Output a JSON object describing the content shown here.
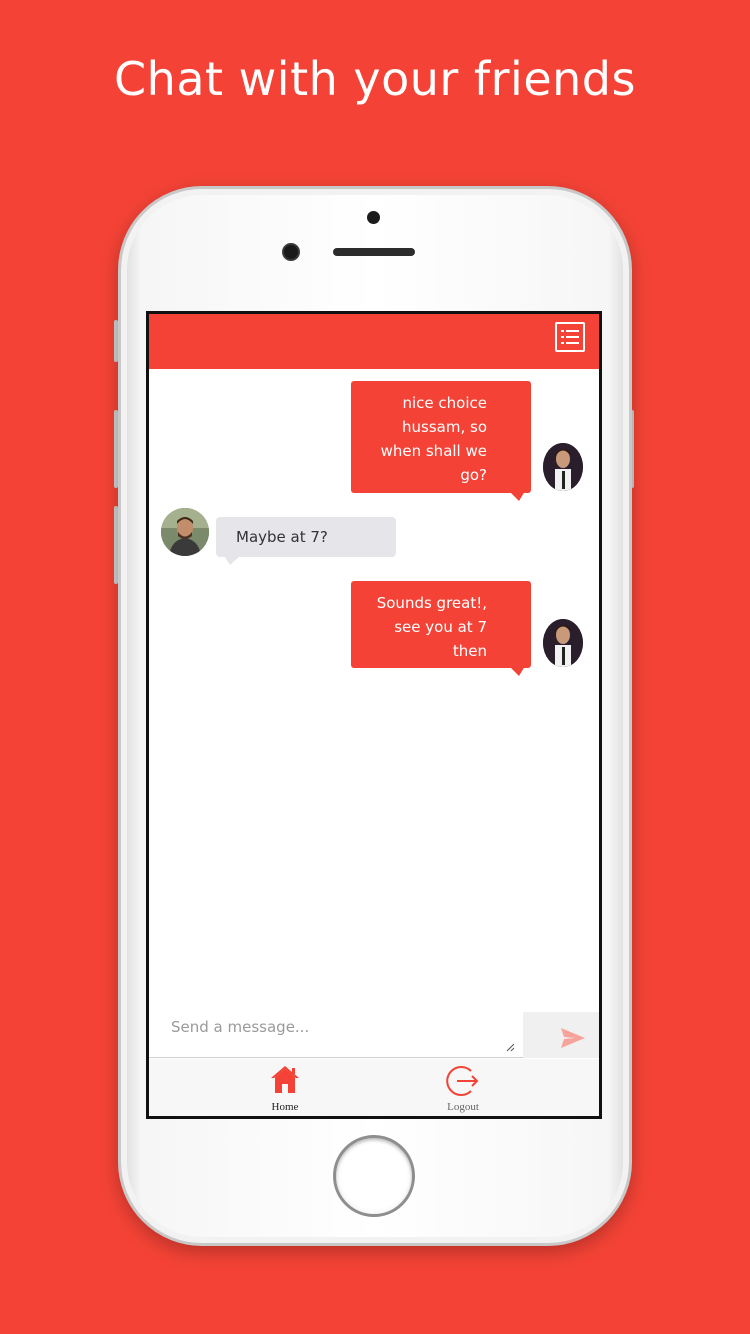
{
  "headline": "Chat with your friends",
  "colors": {
    "accent": "#f44336",
    "incoming_bubble": "#e5e5ea",
    "tab_inactive": "#666666"
  },
  "header": {
    "menu_icon": "list-menu-icon"
  },
  "messages": [
    {
      "direction": "outgoing",
      "text": "nice choice\nhussam, so\nwhen shall we\ngo?"
    },
    {
      "direction": "incoming",
      "text": "Maybe at 7?"
    },
    {
      "direction": "outgoing",
      "text": "Sounds great!,\nsee you at 7\nthen"
    }
  ],
  "composer": {
    "placeholder": "Send a message...",
    "send_icon": "send-icon"
  },
  "tabs": [
    {
      "label": "Home",
      "icon": "home-icon",
      "active": true
    },
    {
      "label": "Logout",
      "icon": "logout-icon",
      "active": false
    }
  ]
}
